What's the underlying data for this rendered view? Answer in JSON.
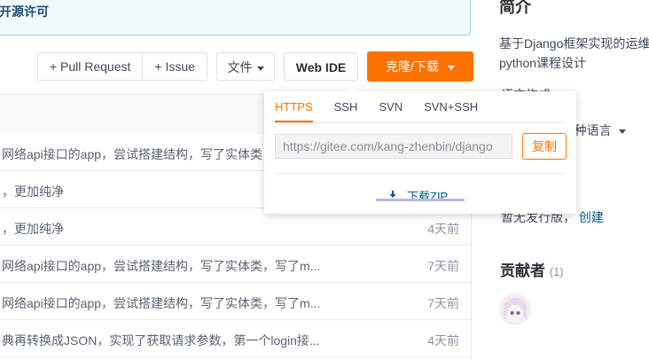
{
  "banner": {
    "license_text": "开源许可"
  },
  "toolbar": {
    "pull_request": "+ Pull Request",
    "issue": "+ Issue",
    "file": "文件",
    "web_ide": "Web IDE",
    "clone": "克隆/下载"
  },
  "clone_popup": {
    "tabs": [
      "HTTPS",
      "SSH",
      "SVN",
      "SVN+SSH"
    ],
    "active_tab": "HTTPS",
    "url": "https://gitee.com/kang-zhenbin/django",
    "copy": "复制",
    "download_zip": "下载ZIP"
  },
  "commits": [
    {
      "message": "网络api接口的app，尝试搭建结构，写了实体类，写了m",
      "time": ""
    },
    {
      "message": "，更加纯净",
      "time": ""
    },
    {
      "message": "，更加纯净",
      "time": "4天前"
    },
    {
      "message": "网络api接口的app，尝试搭建结构，写了实体类，写了m...",
      "time": "7天前"
    },
    {
      "message": "网络api接口的app，尝试搭建结构，写了实体类，写了m...",
      "time": "7天前"
    },
    {
      "message": "典再转换成JSON，实现了获取请求参数，第一个login接...",
      "time": "4天前"
    }
  ],
  "sidebar": {
    "intro_title": "简介",
    "intro_text": "基于Django框架实现的运维python课程设计",
    "partial_heading": "语言构成",
    "languages": "等 3 种语言",
    "release_text": "暂无发行版，",
    "release_link": "创建",
    "contributors_title": "贡献者",
    "contributors_count": "(1)"
  },
  "colors": {
    "accent": "#fe7300",
    "link": "#005980"
  }
}
